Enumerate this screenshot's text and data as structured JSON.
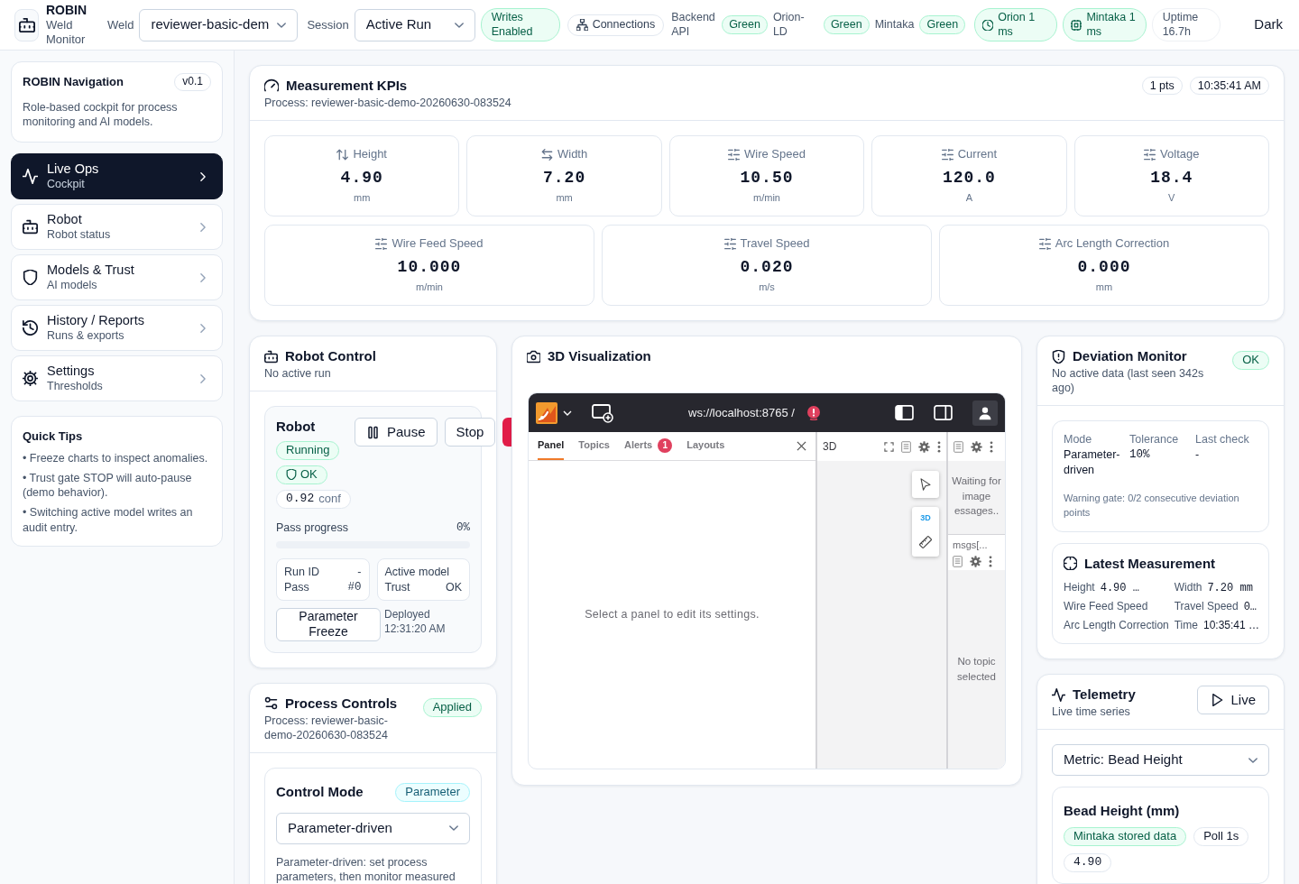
{
  "header": {
    "brand": {
      "title": "ROBIN",
      "subtitle": "Weld Monitor"
    },
    "weld": {
      "label": "Weld",
      "value": "reviewer-basic-dem"
    },
    "session": {
      "label": "Session",
      "value": "Active Run"
    },
    "writes_badge": "Writes Enabled",
    "connections_button": "Connections",
    "services": [
      {
        "label": "Backend API",
        "status": "Green"
      },
      {
        "label": "Orion-LD",
        "status": "Green"
      },
      {
        "label": "Mintaka",
        "status": "Green"
      }
    ],
    "latency": [
      {
        "kind": "clock",
        "text": "Orion 1 ms"
      },
      {
        "kind": "chip",
        "text": "Mintaka 1 ms"
      }
    ],
    "uptime": "Uptime 16.7h",
    "theme_button": "Dark"
  },
  "sidebar": {
    "intro": {
      "title": "ROBIN Navigation",
      "version": "v0.1",
      "description": "Role-based cockpit for process monitoring and AI models."
    },
    "items": [
      {
        "kind": "activity",
        "title": "Live Ops",
        "subtitle": "Cockpit",
        "selected": true
      },
      {
        "kind": "robot",
        "title": "Robot",
        "subtitle": "Robot status",
        "selected": false
      },
      {
        "kind": "shield",
        "title": "Models & Trust",
        "subtitle": "AI models",
        "selected": false
      },
      {
        "kind": "history",
        "title": "History / Reports",
        "subtitle": "Runs & exports",
        "selected": false
      },
      {
        "kind": "gear",
        "title": "Settings",
        "subtitle": "Thresholds",
        "selected": false
      }
    ],
    "tips": {
      "title": "Quick Tips",
      "items": [
        "• Freeze charts to inspect anomalies.",
        "• Trust gate STOP will auto-pause (demo behavior).",
        "• Switching active model writes an audit entry."
      ]
    }
  },
  "kpis": {
    "title": "Measurement KPIs",
    "process": "Process: reviewer-basic-demo-20260630-083524",
    "points": "1 pts",
    "timestamp": "10:35:41 AM",
    "rows": [
      {
        "tiles": [
          {
            "kind": "height",
            "label": "Height",
            "value": "4.90",
            "unit": "mm"
          },
          {
            "kind": "width",
            "label": "Width",
            "value": "7.20",
            "unit": "mm"
          },
          {
            "kind": "parameter",
            "label": "Wire Speed",
            "value": "10.50",
            "unit": "m/min"
          },
          {
            "kind": "parameter",
            "label": "Current",
            "value": "120.0",
            "unit": "A"
          },
          {
            "kind": "parameter",
            "label": "Voltage",
            "value": "18.4",
            "unit": "V"
          }
        ]
      },
      {
        "tiles": [
          {
            "kind": "parameter",
            "label": "Wire Feed Speed",
            "value": "10.000",
            "unit": "m/min"
          },
          {
            "kind": "parameter",
            "label": "Travel Speed",
            "value": "0.020",
            "unit": "m/s"
          },
          {
            "kind": "parameter",
            "label": "Arc Length Correction",
            "value": "0.000",
            "unit": "mm"
          }
        ]
      }
    ]
  },
  "robot_control": {
    "title": "Robot Control",
    "subtitle": "No active run",
    "robot": {
      "title": "Robot",
      "state": "Running",
      "safety": "OK",
      "confidence": "0.92",
      "confidence_unit": "conf"
    },
    "buttons": [
      {
        "kind": "pause",
        "label": "Pause"
      },
      {
        "kind": "plain",
        "label": "Stop"
      },
      {
        "kind": "danger"
      }
    ],
    "progress": {
      "label": "Pass progress",
      "reading": "0%",
      "level": 0
    },
    "info_cards": [
      {
        "rows": [
          {
            "label": "Run ID",
            "value": "-",
            "kind": "text"
          },
          {
            "label": "Pass",
            "value": "#0",
            "kind": "mono"
          }
        ]
      },
      {
        "rows": [
          {
            "label": "Active model"
          },
          {
            "label": "Trust",
            "value": "OK",
            "kind": "text"
          }
        ]
      }
    ],
    "freeze_button": "Parameter Freeze",
    "deployed": "Deployed 12:31:20 AM"
  },
  "process_controls": {
    "title": "Process Controls",
    "subtitle": "Process: reviewer-basic-demo-20260630-083524",
    "status": "Applied",
    "mode": {
      "title": "Control Mode",
      "badge": "Parameter",
      "value": "Parameter-driven",
      "description": "Parameter-driven: set process parameters, then monitor measured"
    }
  },
  "visualization": {
    "title": "3D Visualization",
    "app": {
      "connection": "ws://localhost:8765 /",
      "tabs": [
        {
          "label": "Panel",
          "selected": true
        },
        {
          "label": "Topics",
          "selected": false
        },
        {
          "label": "Alerts",
          "selected": false,
          "count": "1"
        },
        {
          "label": "Layouts",
          "selected": false
        }
      ],
      "settings_message": "Select a panel to edit its settings.",
      "scene_panel": {
        "title": "3D",
        "view_toggle": "3D"
      },
      "image_panel": {
        "message_lines": [
          "Waiting for",
          "image",
          "essages.."
        ]
      },
      "topic_panel": {
        "title": "msgs[...",
        "message": "No topic selected"
      }
    }
  },
  "deviation": {
    "title": "Deviation Monitor",
    "subtitle": "No active data (last seen 342s ago)",
    "status": "OK",
    "fields": [
      {
        "label": "Mode",
        "value": "Parameter-driven",
        "kind": "text"
      },
      {
        "label": "Tolerance",
        "value": "10%",
        "kind": "mono"
      },
      {
        "label": "Last check",
        "value": "-",
        "kind": "text"
      }
    ],
    "warning": "Warning gate: 0/2 consecutive deviation points",
    "latest": {
      "title": "Latest Measurement",
      "items": [
        {
          "label": "Height",
          "value": "4.90 …",
          "kind": "mono"
        },
        {
          "label": "Width",
          "value": "7.20 mm",
          "kind": "mono"
        },
        {
          "label": "Wire Feed Speed"
        },
        {
          "label": "Travel Speed",
          "value": "0…",
          "kind": "mono"
        },
        {
          "label": "Arc Length Correction"
        },
        {
          "label": "Time",
          "value": "10:35:41 …",
          "kind": "text"
        }
      ]
    }
  },
  "telemetry": {
    "title": "Telemetry",
    "subtitle": "Live time series",
    "live_button": "Live",
    "metric": "Metric: Bead Height",
    "series": {
      "title": "Bead Height (mm)",
      "source": "Mintaka stored data",
      "poll": "Poll 1s",
      "reading": "4.90"
    }
  }
}
